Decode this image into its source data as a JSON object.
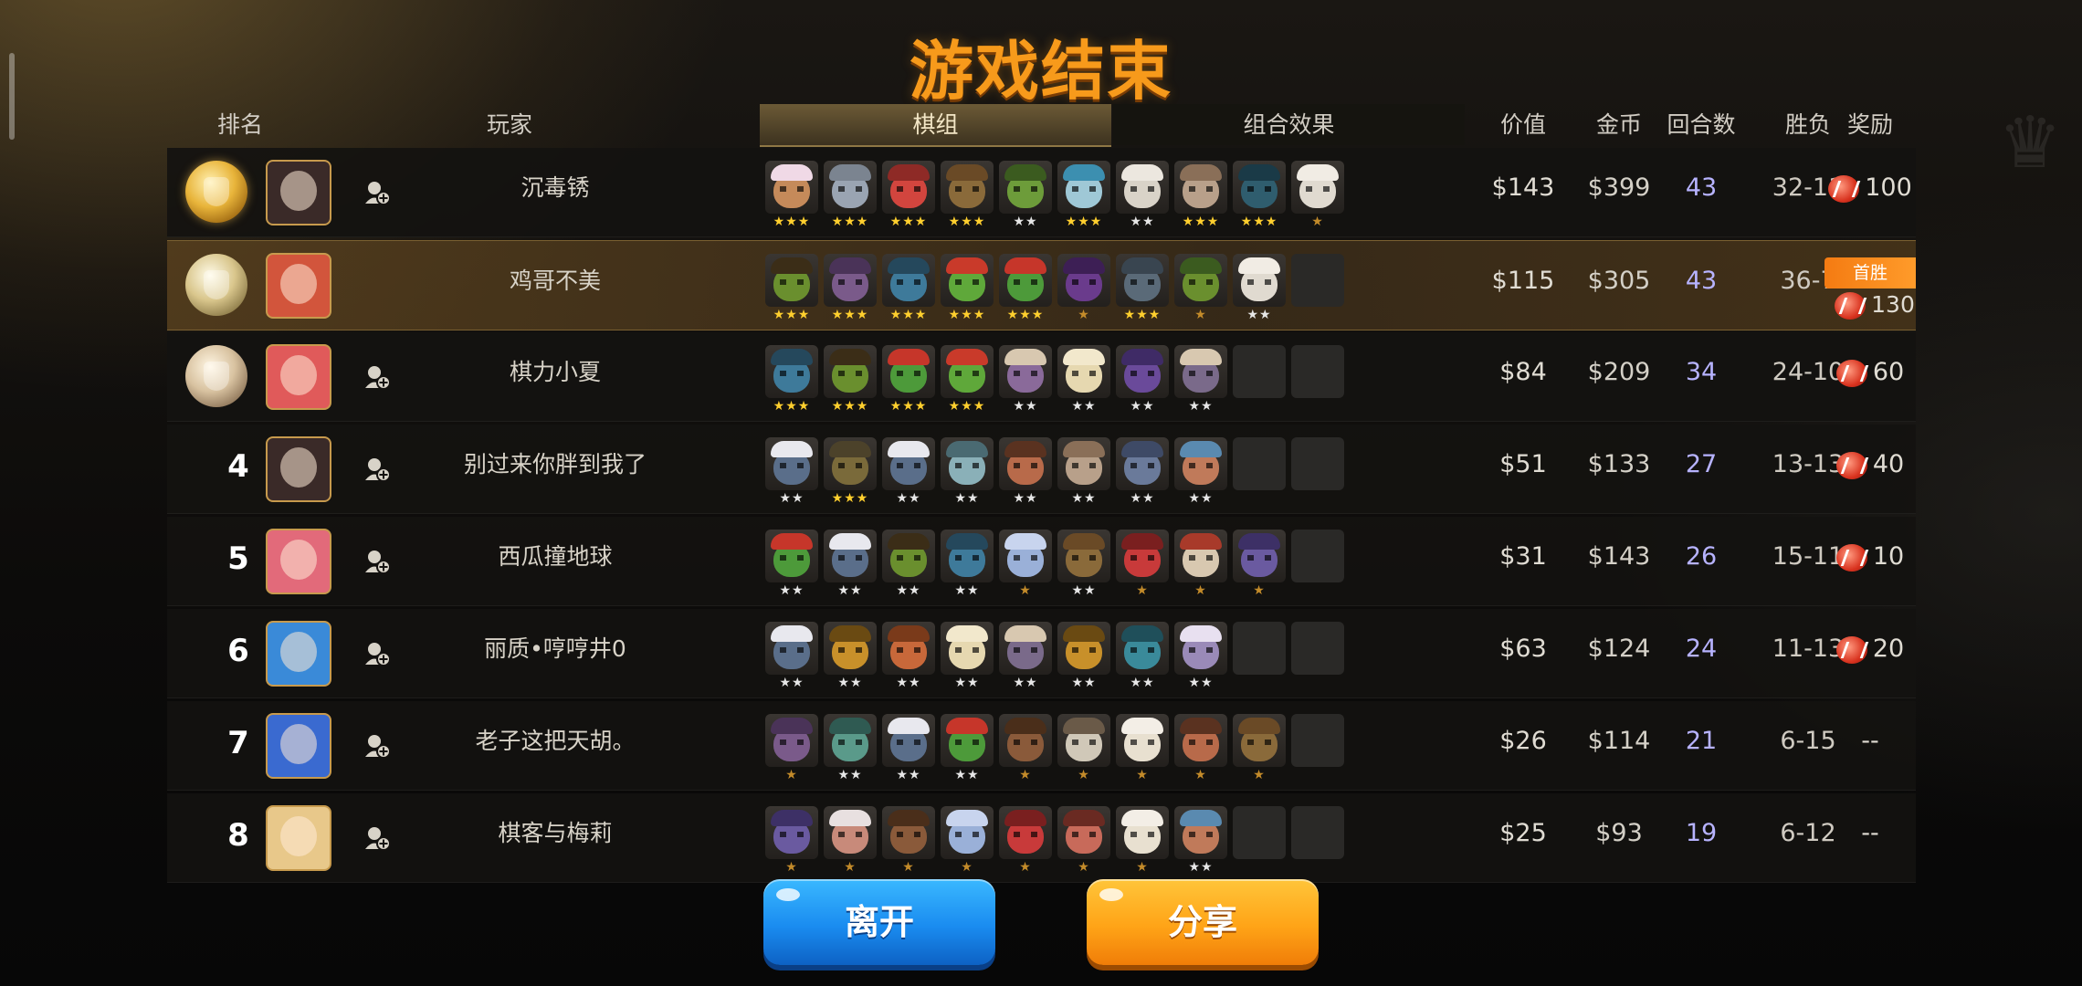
{
  "title": "游戏结束",
  "headers": {
    "rank": "排名",
    "player": "玩家",
    "lineup_tab": "棋组",
    "synergy_tab": "组合效果",
    "value": "价值",
    "gold": "金币",
    "rounds": "回合数",
    "win_loss": "胜负",
    "reward": "奖励"
  },
  "first_win_label": "首胜",
  "colors": {
    "title": "#f79a1b",
    "accent_gold": "#c79a4d",
    "rounds_text": "#b7b3ff",
    "leave_button": "#1a8cf0",
    "share_button": "#ffa417"
  },
  "players": [
    {
      "rank": "1",
      "medal": "gold",
      "name": "沉毒锈",
      "value": "$143",
      "gold": "$399",
      "rounds": "43",
      "win_loss": "32-11",
      "reward": "100",
      "add_friend": true,
      "me": false,
      "avatar_color": "#3a2a28",
      "units": [
        {
          "color": "#c58a5a",
          "hair": "#f0d9e6",
          "stars": 3
        },
        {
          "color": "#9aa4b2",
          "hair": "#7b8490",
          "stars": 3
        },
        {
          "color": "#d2453e",
          "hair": "#8e2a26",
          "stars": 3
        },
        {
          "color": "#8a6a3a",
          "hair": "#6a4a26",
          "stars": 3
        },
        {
          "color": "#6d9c3a",
          "hair": "#3b5b1f",
          "stars": 2
        },
        {
          "color": "#9fc8d6",
          "hair": "#3c8fb0",
          "stars": 3
        },
        {
          "color": "#d9d3c8",
          "hair": "#ece7df",
          "stars": 2
        },
        {
          "color": "#b8a08a",
          "hair": "#8a6f58",
          "stars": 3
        },
        {
          "color": "#2f5d6e",
          "hair": "#1a3a47",
          "stars": 3
        },
        {
          "color": "#e0dad0",
          "hair": "#f1ece4",
          "stars": 1
        }
      ]
    },
    {
      "rank": "2",
      "medal": "silver",
      "name": "鸡哥不美",
      "value": "$115",
      "gold": "$305",
      "rounds": "43",
      "win_loss": "36-7",
      "reward": "130",
      "add_friend": false,
      "me": true,
      "avatar_color": "#d2553c",
      "units": [
        {
          "color": "#6a8f2e",
          "hair": "#3b2d17",
          "stars": 3
        },
        {
          "color": "#7a5a8a",
          "hair": "#4a3358",
          "stars": 3
        },
        {
          "color": "#3e7a9a",
          "hair": "#25485c",
          "stars": 3
        },
        {
          "color": "#5fa83a",
          "hair": "#c93a2a",
          "stars": 3
        },
        {
          "color": "#4d9a3a",
          "hair": "#c6362a",
          "stars": 3
        },
        {
          "color": "#6a3b8c",
          "hair": "#3d1f55",
          "stars": 1
        },
        {
          "color": "#5a6a78",
          "hair": "#394550",
          "stars": 3
        },
        {
          "color": "#6a8f2e",
          "hair": "#3b5b1f",
          "stars": 1
        },
        {
          "color": "#e0dad0",
          "hair": "#f1ece4",
          "stars": 2
        },
        null
      ]
    },
    {
      "rank": "3",
      "medal": "bronze",
      "name": "棋力小夏",
      "value": "$84",
      "gold": "$209",
      "rounds": "34",
      "win_loss": "24-10",
      "reward": "60",
      "add_friend": true,
      "me": false,
      "avatar_color": "#e05a5a",
      "units": [
        {
          "color": "#3e7a9a",
          "hair": "#25485c",
          "stars": 3
        },
        {
          "color": "#6a8f2e",
          "hair": "#3b2d17",
          "stars": 3
        },
        {
          "color": "#4d9a3a",
          "hair": "#c6362a",
          "stars": 3
        },
        {
          "color": "#5fa83a",
          "hair": "#c93a2a",
          "stars": 3
        },
        {
          "color": "#8a6a9a",
          "hair": "#d8c8b0",
          "stars": 2
        },
        {
          "color": "#e6d8b0",
          "hair": "#f2e8cc",
          "stars": 2
        },
        {
          "color": "#6a4a9a",
          "hair": "#3f2b66",
          "stars": 2
        },
        {
          "color": "#7a6a8a",
          "hair": "#d8c8b0",
          "stars": 2
        },
        null,
        null
      ]
    },
    {
      "rank": "4",
      "medal": "",
      "name": "别过来你胖到我了",
      "value": "$51",
      "gold": "$133",
      "rounds": "27",
      "win_loss": "13-13",
      "reward": "40",
      "add_friend": true,
      "me": false,
      "avatar_color": "#3a2a28",
      "units": [
        {
          "color": "#5a6e8a",
          "hair": "#e8e8ee",
          "stars": 2
        },
        {
          "color": "#7a6a3a",
          "hair": "#4c422a",
          "stars": 3
        },
        {
          "color": "#5a6e8a",
          "hair": "#e8e8ee",
          "stars": 2
        },
        {
          "color": "#8ab0b8",
          "hair": "#4a6a72",
          "stars": 2
        },
        {
          "color": "#b86a4a",
          "hair": "#5a3220",
          "stars": 2
        },
        {
          "color": "#b8a08a",
          "hair": "#8a6f58",
          "stars": 2
        },
        {
          "color": "#6a7a9a",
          "hair": "#3e4a66",
          "stars": 2
        },
        {
          "color": "#c07a5a",
          "hair": "#5a8ab0",
          "stars": 2
        },
        null,
        null
      ]
    },
    {
      "rank": "5",
      "medal": "",
      "name": "西瓜撞地球",
      "value": "$31",
      "gold": "$143",
      "rounds": "26",
      "win_loss": "15-11",
      "reward": "10",
      "add_friend": true,
      "me": false,
      "avatar_color": "#e26a7a",
      "units": [
        {
          "color": "#4d9a3a",
          "hair": "#c6362a",
          "stars": 2
        },
        {
          "color": "#5a6e8a",
          "hair": "#e8e8ee",
          "stars": 2
        },
        {
          "color": "#6a8f2e",
          "hair": "#3b2d17",
          "stars": 2
        },
        {
          "color": "#3e7a9a",
          "hair": "#25485c",
          "stars": 2
        },
        {
          "color": "#9ab0d8",
          "hair": "#c8d4ee",
          "stars": 1
        },
        {
          "color": "#8a6a3a",
          "hair": "#6a4a26",
          "stars": 2
        },
        {
          "color": "#c83a3a",
          "hair": "#7a1f1f",
          "stars": 1
        },
        {
          "color": "#d8c8b0",
          "hair": "#a83a2a",
          "stars": 1
        },
        {
          "color": "#6a5aa0",
          "hair": "#3d3066",
          "stars": 1
        },
        null
      ]
    },
    {
      "rank": "6",
      "medal": "",
      "name": "丽质•哼哼井0",
      "value": "$63",
      "gold": "$124",
      "rounds": "24",
      "win_loss": "11-13",
      "reward": "20",
      "add_friend": true,
      "me": false,
      "avatar_color": "#3a8ad8",
      "units": [
        {
          "color": "#5a6e8a",
          "hair": "#e8e8ee",
          "stars": 2
        },
        {
          "color": "#c8902a",
          "hair": "#6a4a12",
          "stars": 2
        },
        {
          "color": "#c8683a",
          "hair": "#7a3a1a",
          "stars": 2
        },
        {
          "color": "#e6d8b0",
          "hair": "#f2e8cc",
          "stars": 2
        },
        {
          "color": "#7a6a8a",
          "hair": "#d8c8b0",
          "stars": 2
        },
        {
          "color": "#c8902a",
          "hair": "#6a4a12",
          "stars": 2
        },
        {
          "color": "#3a8a9a",
          "hair": "#1f4f5a",
          "stars": 2
        },
        {
          "color": "#9a8ab8",
          "hair": "#e8e0f0",
          "stars": 2
        },
        null,
        null
      ]
    },
    {
      "rank": "7",
      "medal": "",
      "name": "老子这把天胡。",
      "value": "$26",
      "gold": "$114",
      "rounds": "21",
      "win_loss": "6-15",
      "reward": "--",
      "add_friend": true,
      "me": false,
      "avatar_color": "#3a6ad0",
      "units": [
        {
          "color": "#7a5a8a",
          "hair": "#4a3358",
          "stars": 1
        },
        {
          "color": "#5a9a8a",
          "hair": "#2f5a52",
          "stars": 2
        },
        {
          "color": "#5a6e8a",
          "hair": "#e8e8ee",
          "stars": 2
        },
        {
          "color": "#4d9a3a",
          "hair": "#c6362a",
          "stars": 2
        },
        {
          "color": "#8a5a3a",
          "hair": "#4a2e1a",
          "stars": 1
        },
        {
          "color": "#d0c8b8",
          "hair": "#6a5a48",
          "stars": 1
        },
        {
          "color": "#e8e0d0",
          "hair": "#f3eee6",
          "stars": 1
        },
        {
          "color": "#b86a4a",
          "hair": "#5a3220",
          "stars": 1
        },
        {
          "color": "#8a6a3a",
          "hair": "#6a4a26",
          "stars": 1
        },
        null
      ]
    },
    {
      "rank": "8",
      "medal": "",
      "name": "棋客与梅莉",
      "value": "$25",
      "gold": "$93",
      "rounds": "19",
      "win_loss": "6-12",
      "reward": "--",
      "add_friend": true,
      "me": false,
      "avatar_color": "#e8c88a",
      "units": [
        {
          "color": "#6a5aa0",
          "hair": "#3d3066",
          "stars": 1
        },
        {
          "color": "#c88a7a",
          "hair": "#e8e0e0",
          "stars": 1
        },
        {
          "color": "#8a5a3a",
          "hair": "#4a2e1a",
          "stars": 1
        },
        {
          "color": "#9ab0d8",
          "hair": "#c8d4ee",
          "stars": 1
        },
        {
          "color": "#c83a3a",
          "hair": "#7a1f1f",
          "stars": 1
        },
        {
          "color": "#c86a5a",
          "hair": "#6a2a22",
          "stars": 1
        },
        {
          "color": "#e8e0d0",
          "hair": "#f3eee6",
          "stars": 1
        },
        {
          "color": "#c07a5a",
          "hair": "#5a8ab0",
          "stars": 2
        },
        null,
        null
      ]
    }
  ],
  "buttons": {
    "leave": "离开",
    "share": "分享"
  }
}
